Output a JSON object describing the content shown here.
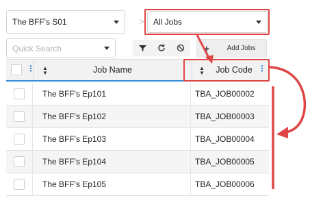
{
  "toolbar": {
    "scene_select": "The BFF's S01",
    "separator": ">",
    "jobs_select": "All Jobs",
    "search_placeholder": "Quick Search",
    "add_jobs_label": "Add Jobs"
  },
  "table": {
    "columns": {
      "name": "Job Name",
      "code": "Job Code"
    },
    "rows": [
      {
        "name": "The BFF's Ep101",
        "code": "TBA_JOB00002"
      },
      {
        "name": "The BFF's Ep102",
        "code": "TBA_JOB00003"
      },
      {
        "name": "The BFF's Ep103",
        "code": "TBA_JOB00004"
      },
      {
        "name": "The BFF's Ep104",
        "code": "TBA_JOB00005"
      },
      {
        "name": "The BFF's Ep105",
        "code": "TBA_JOB00006"
      }
    ]
  },
  "colors": {
    "annotation": "#e04545",
    "accent": "#3b8ed8"
  },
  "icons": [
    "chevron-right-icon",
    "filter-icon",
    "refresh-icon",
    "clear-icon",
    "plus-icon",
    "sort-icon",
    "column-menu-icon"
  ]
}
